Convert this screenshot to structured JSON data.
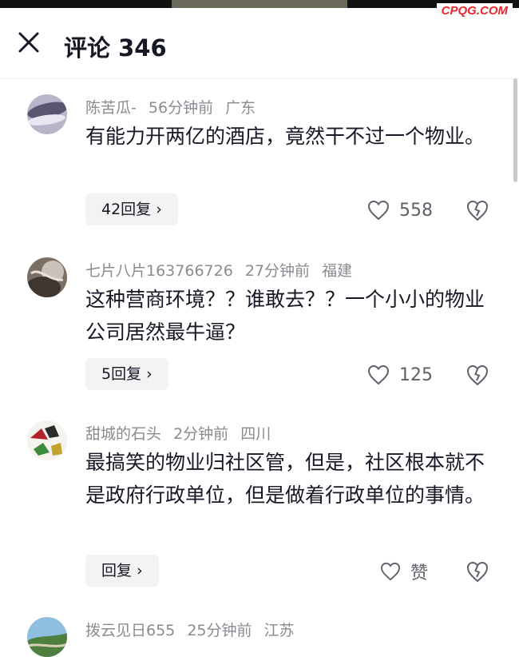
{
  "watermark": "CPQG.COM",
  "header": {
    "title": "评论 346"
  },
  "comments": [
    {
      "user": "陈苦瓜-",
      "time": "56分钟前",
      "location": "广东",
      "text": "有能力开两亿的酒店，竟然干不过一个物业。",
      "reply_label": "42回复 ›",
      "likes": "558"
    },
    {
      "user": "七片八片163766726",
      "time": "27分钟前",
      "location": "福建",
      "text": "这种营商环境？？谁敢去？？一个小小的物业公司居然最牛逼？",
      "reply_label": "5回复 ›",
      "likes": "125"
    },
    {
      "user": "甜城的石头",
      "time": "2分钟前",
      "location": "四川",
      "text": "最搞笑的物业归社区管，但是，社区根本就不是政府行政单位，但是做着行政单位的事情。",
      "reply_label": "回复 ›",
      "likes": "赞"
    },
    {
      "user": "拨云见日655",
      "time": "25分钟前",
      "location": "江苏"
    }
  ]
}
